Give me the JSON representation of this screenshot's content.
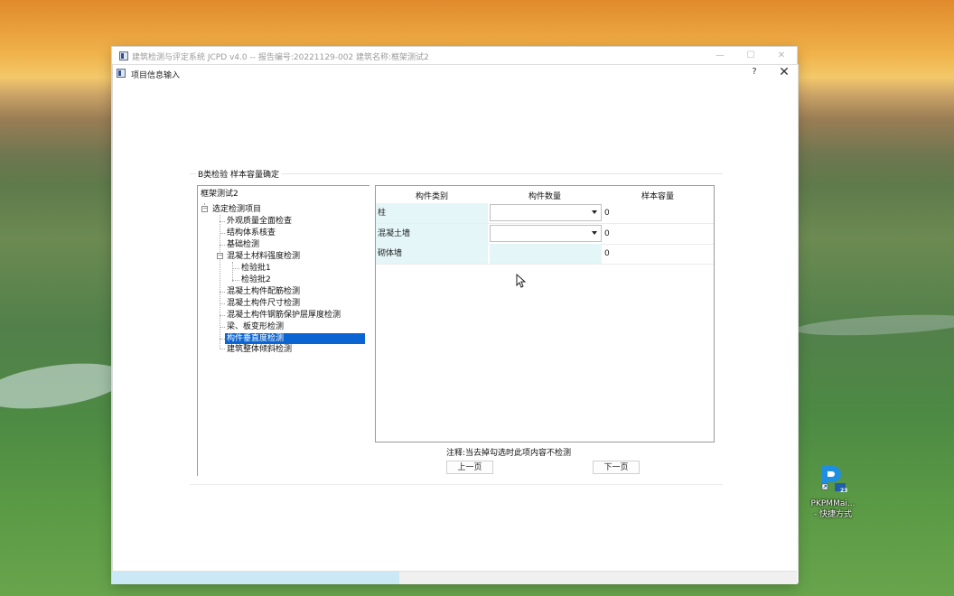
{
  "colors": {
    "selection": "#0a64d2",
    "table_name_bg": "#e4f6f8",
    "progress_fill": "#cbe8f6"
  },
  "app_window": {
    "title": "建筑检测与评定系统 JCPD v4.0 --  报告编号:20221129-002  建筑名称:框架测试2",
    "buttons": {
      "minimize": "—",
      "maximize": "☐",
      "close": "✕"
    }
  },
  "dialog": {
    "title": "项目信息输入",
    "help": "?",
    "close": "✕",
    "group_title": "B类检验 样本容量确定",
    "tree": {
      "root": "框架测试2",
      "items": [
        {
          "label": "选定检测项目",
          "level": 1,
          "toggle": "−"
        },
        {
          "label": "外观质量全面检查",
          "level": 2
        },
        {
          "label": "结构体系核查",
          "level": 2
        },
        {
          "label": "基础检测",
          "level": 2
        },
        {
          "label": "混凝土材料强度检测",
          "level": 2,
          "toggle": "−"
        },
        {
          "label": "检验批1",
          "level": 3
        },
        {
          "label": "检验批2",
          "level": 3
        },
        {
          "label": "混凝土构件配筋检测",
          "level": 2
        },
        {
          "label": "混凝土构件尺寸检测",
          "level": 2
        },
        {
          "label": "混凝土构件钢筋保护层厚度检测",
          "level": 2
        },
        {
          "label": "梁、板变形检测",
          "level": 2
        },
        {
          "label": "构件垂直度检测",
          "level": 2,
          "selected": true
        },
        {
          "label": "建筑整体倾斜检测",
          "level": 2
        }
      ]
    },
    "table": {
      "headers": [
        "构件类别",
        "构件数量",
        "样本容量"
      ],
      "rows": [
        {
          "name": "柱",
          "quantity": "",
          "has_dropdown": true,
          "sample": "0"
        },
        {
          "name": "混凝土墙",
          "quantity": "",
          "has_dropdown": true,
          "sample": "0"
        },
        {
          "name": "砌体墙",
          "quantity": "",
          "has_dropdown": false,
          "sample": "0"
        }
      ]
    },
    "note": "注释:当去掉勾选时此项内容不检测",
    "prev_button": "上一页",
    "next_button": "下一页"
  },
  "progress": {
    "fraction": 0.42
  },
  "desktop_icon": {
    "label_line1": "PKPMMai...",
    "label_line2": "- 快捷方式",
    "badge": "23"
  }
}
